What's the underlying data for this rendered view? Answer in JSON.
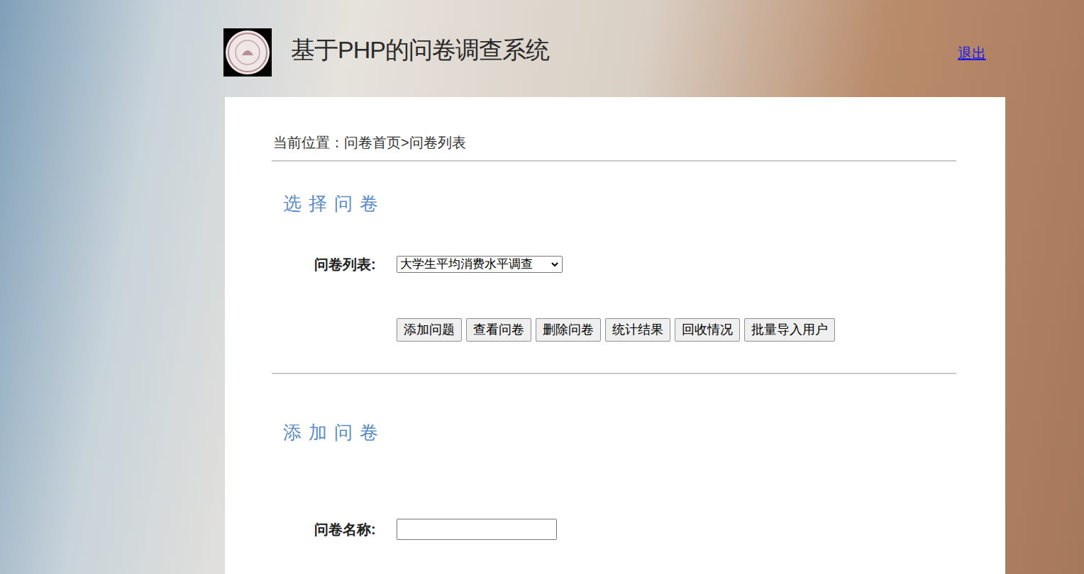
{
  "header": {
    "title": "基于PHP的问卷调查系统",
    "logout": "退出"
  },
  "breadcrumb": "当前位置：问卷首页>问卷列表",
  "select_section": {
    "title": "选择问卷",
    "label": "问卷列表:",
    "selected_option": "大学生平均消费水平调查",
    "buttons": [
      "添加问题",
      "查看问卷",
      "删除问卷",
      "统计结果",
      "回收情况",
      "批量导入用户"
    ]
  },
  "add_section": {
    "title": "添加问卷",
    "name_label": "问卷名称:",
    "name_value": ""
  }
}
